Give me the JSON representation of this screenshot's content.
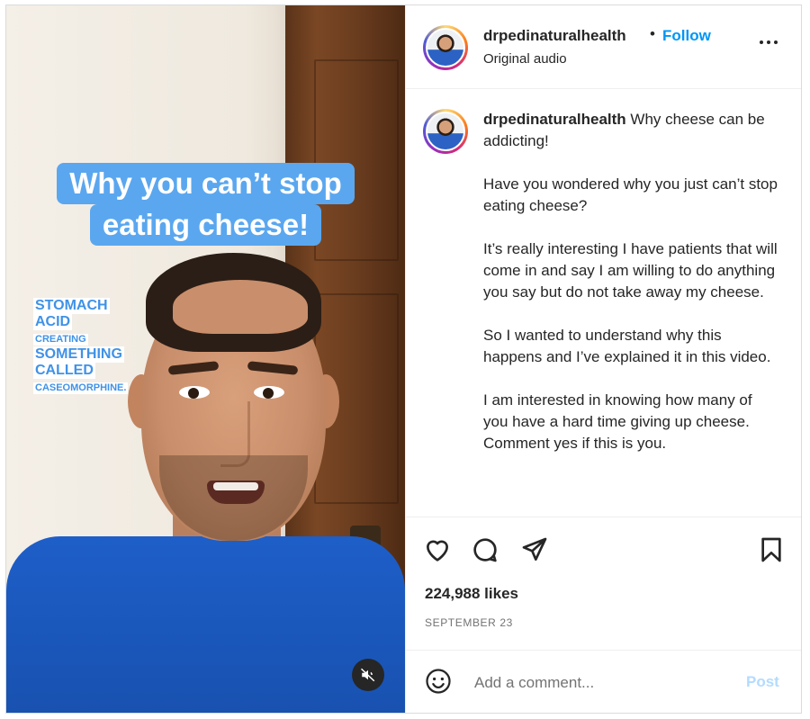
{
  "post": {
    "username": "drpedinaturalhealth",
    "separator": "•",
    "follow_label": "Follow",
    "audio_label": "Original audio"
  },
  "media": {
    "caption_line1": "Why you can’t stop",
    "caption_line2": "eating cheese!",
    "sticker": {
      "line1": "STOMACH",
      "line2": "ACID",
      "line3": "CREATING",
      "line4": "SOMETHING",
      "line5": "CALLED",
      "line6": "CASEOMORPHINE."
    },
    "mute_icon": "speaker-muted-icon"
  },
  "caption": {
    "username": "drpedinaturalhealth",
    "intro": " Why cheese can be addicting!",
    "paragraphs": [
      "Have you wondered why you just can’t stop eating cheese?",
      "It’s really interesting I have patients that will come in and say I am willing to do anything you say but do not take away my cheese.",
      "So I wanted to understand why this happens and I’ve explained it in this video.",
      "I am interested in knowing how many of you have a hard time giving up cheese. Comment yes if this is you."
    ]
  },
  "actions": {
    "icons": [
      "heart-icon",
      "comment-icon",
      "share-icon",
      "bookmark-icon"
    ],
    "likes": "224,988 likes",
    "date": "SEPTEMBER 23"
  },
  "comment": {
    "placeholder": "Add a comment...",
    "post_label": "Post",
    "emoji_icon": "emoji-icon"
  },
  "colors": {
    "accent": "#0095f6",
    "caption_bg": "#5aa7ef",
    "post_disabled": "#b3dbff",
    "scrubs": "#1b56b8"
  }
}
